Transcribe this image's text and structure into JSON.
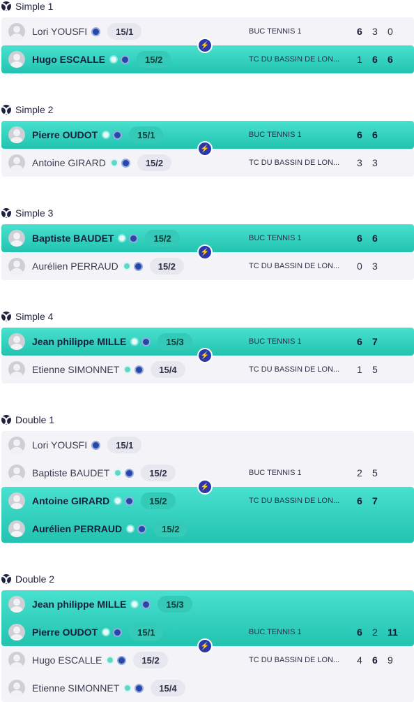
{
  "colors": {
    "win_bg": "#2fd1bf",
    "lose_bg": "#f4f4f8",
    "accent_navy": "#2d38a8",
    "bolt": "#f2d64a"
  },
  "matches": [
    {
      "title": "Simple 1",
      "teams": [
        {
          "winner": false,
          "club": "BUC TENNIS 1",
          "scores": [
            "6",
            "3",
            "0"
          ],
          "players": [
            {
              "name": "Lori YOUSFI",
              "rank": "15/1"
            }
          ]
        },
        {
          "winner": true,
          "club": "TC DU BASSIN DE LON...",
          "scores": [
            "1",
            "6",
            "6"
          ],
          "players": [
            {
              "name": "Hugo ESCALLE",
              "rank": "15/2"
            }
          ]
        }
      ]
    },
    {
      "title": "Simple 2",
      "teams": [
        {
          "winner": true,
          "club": "BUC TENNIS 1",
          "scores": [
            "6",
            "6"
          ],
          "players": [
            {
              "name": "Pierre OUDOT",
              "rank": "15/1"
            }
          ]
        },
        {
          "winner": false,
          "club": "TC DU BASSIN DE LON...",
          "scores": [
            "3",
            "3"
          ],
          "players": [
            {
              "name": "Antoine GIRARD",
              "rank": "15/2"
            }
          ]
        }
      ]
    },
    {
      "title": "Simple 3",
      "teams": [
        {
          "winner": true,
          "club": "BUC TENNIS 1",
          "scores": [
            "6",
            "6"
          ],
          "players": [
            {
              "name": "Baptiste BAUDET",
              "rank": "15/2"
            }
          ]
        },
        {
          "winner": false,
          "club": "TC DU BASSIN DE LON...",
          "scores": [
            "0",
            "3"
          ],
          "players": [
            {
              "name": "Aurélien PERRAUD",
              "rank": "15/2"
            }
          ]
        }
      ]
    },
    {
      "title": "Simple 4",
      "teams": [
        {
          "winner": true,
          "club": "BUC TENNIS 1",
          "scores": [
            "6",
            "7"
          ],
          "players": [
            {
              "name": "Jean philippe MILLE",
              "rank": "15/3"
            }
          ]
        },
        {
          "winner": false,
          "club": "TC DU BASSIN DE LON...",
          "scores": [
            "1",
            "5"
          ],
          "players": [
            {
              "name": "Etienne SIMONNET",
              "rank": "15/4"
            }
          ]
        }
      ]
    },
    {
      "title": "Double 1",
      "teams": [
        {
          "winner": false,
          "club": "BUC TENNIS 1",
          "scores": [
            "2",
            "5"
          ],
          "players": [
            {
              "name": "Lori YOUSFI",
              "rank": "15/1"
            },
            {
              "name": "Baptiste BAUDET",
              "rank": "15/2"
            }
          ]
        },
        {
          "winner": true,
          "club": "TC DU BASSIN DE LON...",
          "scores": [
            "6",
            "7"
          ],
          "players": [
            {
              "name": "Antoine GIRARD",
              "rank": "15/2"
            },
            {
              "name": "Aurélien PERRAUD",
              "rank": "15/2"
            }
          ]
        }
      ]
    },
    {
      "title": "Double 2",
      "teams": [
        {
          "winner": true,
          "club": "BUC TENNIS 1",
          "scores": [
            "6",
            "2",
            "11"
          ],
          "players": [
            {
              "name": "Jean philippe MILLE",
              "rank": "15/3"
            },
            {
              "name": "Pierre OUDOT",
              "rank": "15/1"
            }
          ]
        },
        {
          "winner": false,
          "club": "TC DU BASSIN DE LON...",
          "scores": [
            "4",
            "6",
            "9"
          ],
          "players": [
            {
              "name": "Hugo ESCALLE",
              "rank": "15/2"
            },
            {
              "name": "Etienne SIMONNET",
              "rank": "15/4"
            }
          ]
        }
      ]
    }
  ]
}
